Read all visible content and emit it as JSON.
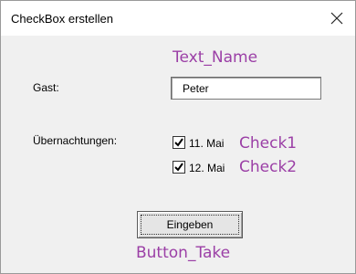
{
  "window": {
    "title": "CheckBox erstellen",
    "close_icon": "close-icon"
  },
  "form": {
    "guest_label": "Gast:",
    "guest_value": "Peter",
    "nights_label": "Übernachtungen:",
    "checkboxes": [
      {
        "label": "11. Mai",
        "checked": true
      },
      {
        "label": "12. Mai",
        "checked": true
      }
    ],
    "submit_label": "Eingeben"
  },
  "annotations": {
    "text_name": "Text_Name",
    "check1": "Check1",
    "check2": "Check2",
    "button_take": "Button_Take",
    "color": "#9b3fa6"
  }
}
